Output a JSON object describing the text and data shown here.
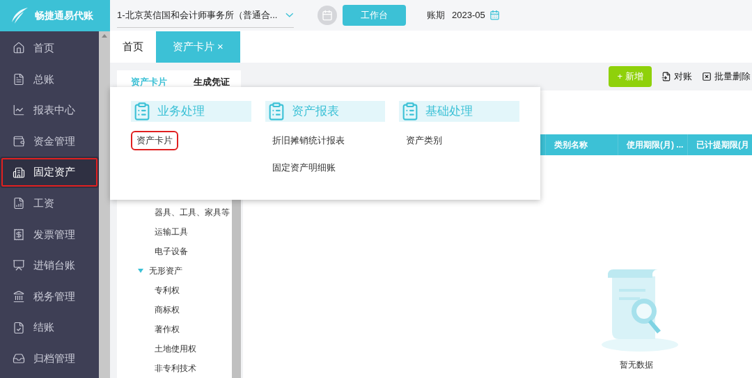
{
  "logo": {
    "text": "畅捷通易代账"
  },
  "sidebar": {
    "items": [
      {
        "label": "首页",
        "selected": false,
        "annotated": false
      },
      {
        "label": "总账",
        "selected": false,
        "annotated": false
      },
      {
        "label": "报表中心",
        "selected": false,
        "annotated": false
      },
      {
        "label": "资金管理",
        "selected": false,
        "annotated": false
      },
      {
        "label": "固定资产",
        "selected": true,
        "annotated": true
      },
      {
        "label": "工资",
        "selected": false,
        "annotated": false
      },
      {
        "label": "发票管理",
        "selected": false,
        "annotated": false
      },
      {
        "label": "进销台账",
        "selected": false,
        "annotated": false
      },
      {
        "label": "税务管理",
        "selected": false,
        "annotated": false
      },
      {
        "label": "结账",
        "selected": false,
        "annotated": false
      },
      {
        "label": "归档管理",
        "selected": false,
        "annotated": false
      }
    ]
  },
  "topbar": {
    "company": "1-北京英信国和会计师事务所（普通合...",
    "workbench_button": "工作台",
    "period_label": "账期",
    "period_value": "2023-05"
  },
  "tabs": [
    {
      "label": "首页",
      "selected": false,
      "closable": false
    },
    {
      "label": "资产卡片",
      "selected": true,
      "closable": true
    }
  ],
  "close_glyph": "×",
  "subtabs": [
    {
      "label": "资产卡片",
      "selected": true
    },
    {
      "label": "生成凭证",
      "selected": false
    }
  ],
  "toolbar": {
    "add_button": "新增",
    "add_glyph": "+",
    "reconcile_button": "对账",
    "batch_delete_button": "批量删除"
  },
  "tree": [
    {
      "label": "器具、工具、家具等"
    },
    {
      "label": "运输工具"
    },
    {
      "label": "电子设备"
    },
    {
      "label": "无形资产",
      "expanded": true,
      "children": [
        {
          "label": "专利权"
        },
        {
          "label": "商标权"
        },
        {
          "label": "著作权"
        },
        {
          "label": "土地使用权"
        },
        {
          "label": "非专利技术"
        }
      ]
    }
  ],
  "table": {
    "columns": [
      "类别名称",
      "使用期限(月) ...",
      "已计提期限(月"
    ],
    "empty_text": "暂无数据"
  },
  "menu": {
    "groups": [
      {
        "title": "业务处理",
        "items": [
          {
            "label": "资产卡片",
            "annotated": true
          }
        ]
      },
      {
        "title": "资产报表",
        "items": [
          {
            "label": "折旧摊销统计报表",
            "annotated": false
          },
          {
            "label": "固定资产明细账",
            "annotated": false
          }
        ]
      },
      {
        "title": "基础处理",
        "items": [
          {
            "label": "资产类别",
            "annotated": false
          }
        ]
      }
    ]
  }
}
